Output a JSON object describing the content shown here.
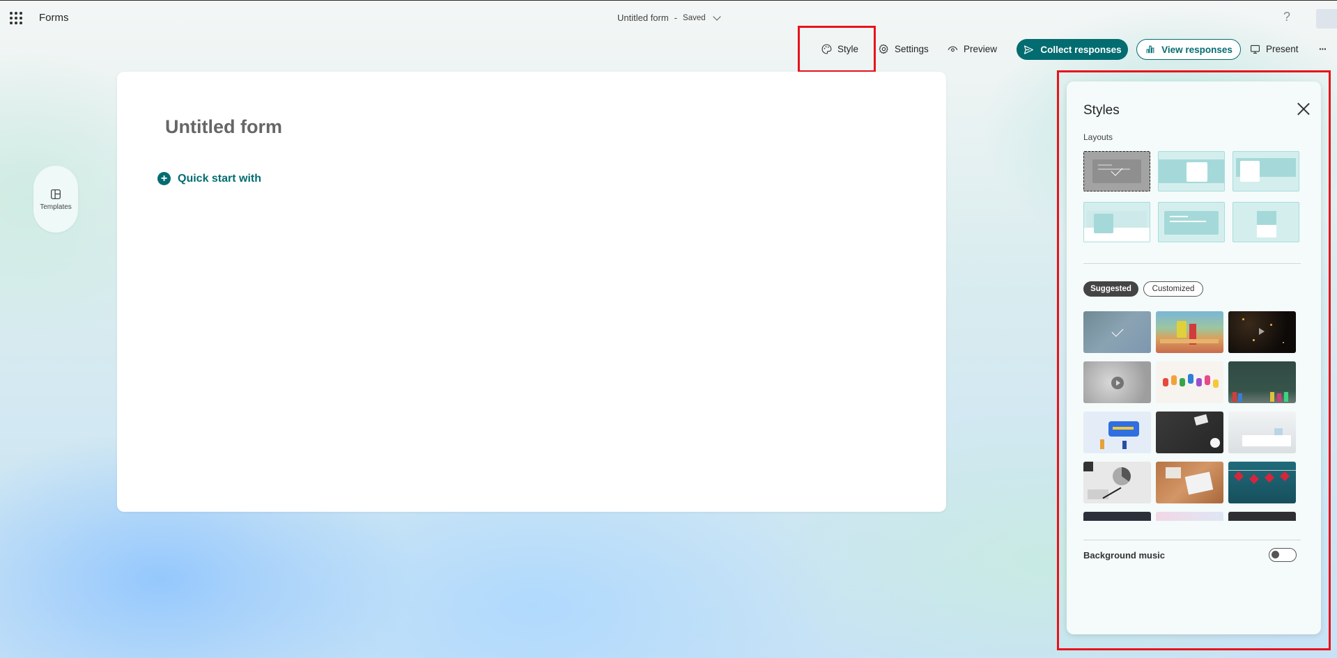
{
  "header": {
    "app_name": "Forms",
    "form_title": "Untitled form",
    "separator": "-",
    "save_status": "Saved",
    "help": "?"
  },
  "toolbar": {
    "style": "Style",
    "settings": "Settings",
    "preview": "Preview",
    "collect": "Collect responses",
    "view": "View responses",
    "present": "Present",
    "more": "···"
  },
  "sidebar": {
    "templates": "Templates"
  },
  "form": {
    "title": "Untitled form",
    "quick_start": "Quick start with"
  },
  "styles_panel": {
    "title": "Styles",
    "layouts_label": "Layouts",
    "tabs": [
      "Suggested",
      "Customized"
    ],
    "active_tab": "Suggested",
    "selected_layout": 1,
    "selected_theme": 1,
    "background_music_label": "Background music",
    "background_music_on": false
  },
  "colors": {
    "accent": "#036c70",
    "highlight_box": "#e8131b"
  }
}
